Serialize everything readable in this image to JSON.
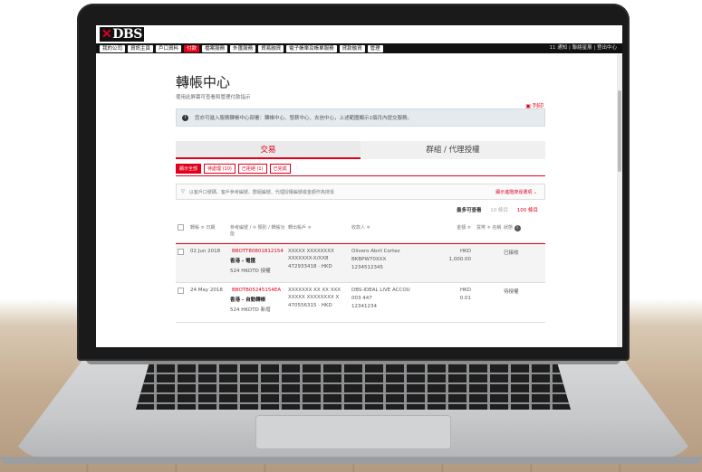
{
  "brand": {
    "logo_mark": "✕",
    "logo_text": "DBS"
  },
  "menu": [
    "我的公司",
    "資訊主頁",
    "戶口資料",
    "付款",
    "檔案服務",
    "外匯服務",
    "貿易融資",
    "電子帳單及帳單服務",
    "貸款融資",
    "管理"
  ],
  "menu_active_index": 3,
  "top_links": "11 通知 | 聯絡星展 | 登出中心",
  "page": {
    "title": "轉帳中心",
    "subtitle": "使用此屏幕可查看和管理付款指示",
    "print_label": "列印",
    "info_text": "您亦可進入服務轉帳中心部署：轉帳中心、發薪中心、去信中心，上述範圍顯示1個月內提交服務。"
  },
  "tabs": [
    {
      "label": "交易",
      "selected": true
    },
    {
      "label": "群組 / 代理授權",
      "selected": false
    }
  ],
  "subtabs": [
    "顯示全部",
    "待處理 (10)",
    "已拒絕 (1)",
    "已完成"
  ],
  "filter": {
    "placeholder": "以客戶口號碼、客戶參考編號、群組編號、代理授權編號或金額作為搜尋",
    "advanced": "顯示進階搜尋選項"
  },
  "paging": {
    "label": "最多可查看",
    "opt1": "10 條目",
    "opt2": "100 條目"
  },
  "table": {
    "headers": [
      "轉帳 ≑ 日期",
      "參考編號 / ≑ 類別 / 轉帳功能",
      "轉出帳戶 ≑",
      "收款人 ≑",
      "金額 ≑",
      "貨幣 ≑ 名稱",
      "狀態"
    ],
    "rows": [
      {
        "date": "02 Jun 2018",
        "ref": "BBOTT80801812154",
        "type": "香港 - 電匯",
        "func": "524 HKDTD 授權",
        "from1": "XXXXX XXXXXXXX",
        "from2": "XXXXXXX-X/XX8",
        "from3": "472933418 · HKD",
        "to1": "Olivero Abril Cortez",
        "to2": "BKBPW70XXX",
        "to3": "1234512345",
        "ccy": "HKD",
        "amt": "1,000.00",
        "status": "已接收",
        "highlight": true
      },
      {
        "date": "24 May 2018",
        "ref": "BBOTB05245154EA",
        "type": "香港 - 自動轉帳",
        "func": "524 HKDTD 新增",
        "from1": "XXXXXXX XX XX XXX",
        "from2": "XXXXX XXXXXXXX X",
        "from3": "470556315 · HKD",
        "to1": "DBS-IDEAL LIVE ACCOU",
        "to2": "003 447",
        "to3": "12341234",
        "ccy": "HKD",
        "amt": "0.01",
        "status": "待授權",
        "highlight": false
      }
    ]
  },
  "colors": {
    "accent": "#e0001b",
    "bar": "#111111"
  }
}
